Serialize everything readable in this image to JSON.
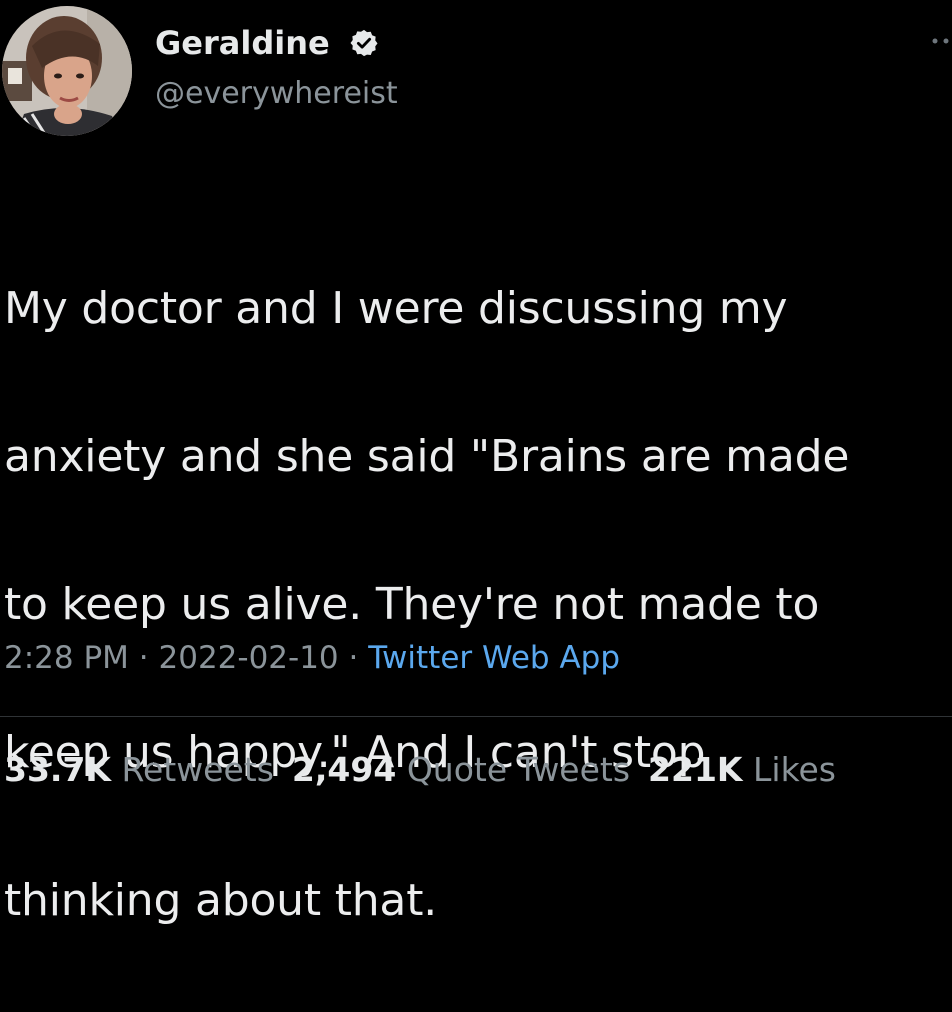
{
  "author": {
    "display_name": "Geraldine",
    "handle": "@everywhereist",
    "verified_icon": "verified-badge-icon"
  },
  "tweet": {
    "text_lines": [
      "My doctor and I were discussing my",
      "anxiety and she said \"Brains are made",
      "to keep us alive. They're not made to",
      "keep us happy.\" And I can't stop",
      "thinking about that."
    ],
    "time": "2:28 PM",
    "separator": "·",
    "date": "2022-02-10",
    "source": "Twitter Web App"
  },
  "stats": {
    "retweets_count": "33.7K",
    "retweets_label": "Retweets",
    "quote_tweets_count": "2,494",
    "quote_tweets_label": "Quote Tweets",
    "likes_count": "221K",
    "likes_label": "Likes"
  },
  "colors": {
    "background": "#000000",
    "text": "#e7e9ea",
    "secondary_text": "#8b949a",
    "link": "#5ba8ee"
  }
}
